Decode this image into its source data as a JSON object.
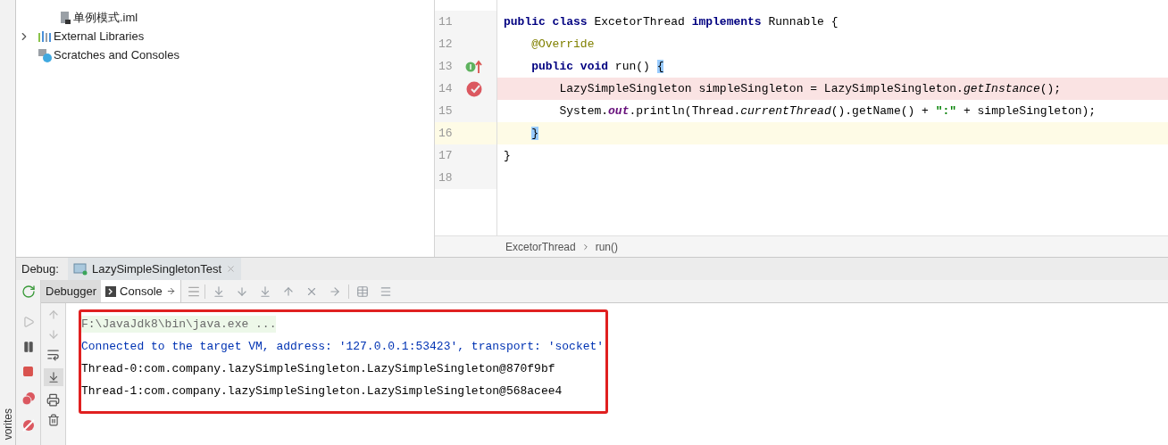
{
  "favorites_bar": {
    "label": "vorites"
  },
  "project_tree": {
    "items": [
      {
        "label": "单例模式.iml",
        "kind": "file"
      },
      {
        "label": "External Libraries",
        "kind": "libraries",
        "expanded": false
      },
      {
        "label": "Scratches and Consoles",
        "kind": "scratches"
      }
    ]
  },
  "editor": {
    "lines": [
      {
        "number": "11",
        "breakpoint": false,
        "caret_line": false,
        "implements_marker": false,
        "segments": [
          {
            "text": "public class ",
            "kind": "keyword"
          },
          {
            "text": "ExcetorThread ",
            "kind": "plain"
          },
          {
            "text": "implements ",
            "kind": "keyword"
          },
          {
            "text": "Runnable {",
            "kind": "plain"
          }
        ]
      },
      {
        "number": "12",
        "breakpoint": false,
        "caret_line": false,
        "implements_marker": false,
        "segments": [
          {
            "text": "    @Override",
            "kind": "annotation"
          }
        ]
      },
      {
        "number": "13",
        "breakpoint": false,
        "caret_line": false,
        "implements_marker": true,
        "segments": [
          {
            "text": "    public void ",
            "kind": "keyword"
          },
          {
            "text": "run() ",
            "kind": "plain"
          },
          {
            "text": "{",
            "kind": "brace-match"
          }
        ]
      },
      {
        "number": "14",
        "breakpoint": true,
        "caret_line": false,
        "implements_marker": false,
        "segments": [
          {
            "text": "        LazySimpleSingleton simpleSingleton = LazySimpleSingleton.",
            "kind": "plain"
          },
          {
            "text": "getInstance",
            "kind": "italic"
          },
          {
            "text": "();",
            "kind": "plain"
          }
        ]
      },
      {
        "number": "15",
        "breakpoint": false,
        "caret_line": false,
        "implements_marker": false,
        "segments": [
          {
            "text": "        System.",
            "kind": "plain"
          },
          {
            "text": "out",
            "kind": "static-field"
          },
          {
            "text": ".println(Thread.",
            "kind": "plain"
          },
          {
            "text": "currentThread",
            "kind": "italic"
          },
          {
            "text": "().getName() + ",
            "kind": "plain"
          },
          {
            "text": "\":\"",
            "kind": "string"
          },
          {
            "text": " + simpleSingleton);",
            "kind": "plain"
          }
        ]
      },
      {
        "number": "16",
        "breakpoint": false,
        "caret_line": true,
        "implements_marker": false,
        "segments": [
          {
            "text": "    }",
            "kind": "brace-match"
          }
        ]
      },
      {
        "number": "17",
        "breakpoint": false,
        "caret_line": false,
        "implements_marker": false,
        "segments": [
          {
            "text": "}",
            "kind": "plain"
          }
        ]
      },
      {
        "number": "18",
        "breakpoint": false,
        "caret_line": false,
        "implements_marker": false
      }
    ],
    "breadcrumbs": [
      "ExcetorThread",
      "run()"
    ]
  },
  "debug_panel": {
    "label": "Debug:",
    "session_tabs": [
      {
        "label": "LazySimpleSingletonTest",
        "selected": true
      }
    ],
    "view_tabs": [
      {
        "label": "Debugger",
        "selected": false
      },
      {
        "label": "Console",
        "selected": true
      }
    ],
    "console_lines": [
      {
        "text": "F:\\JavaJdk8\\bin\\java.exe ...",
        "kind": "command"
      },
      {
        "text": "Connected to the target VM, address: '127.0.0.1:53423', transport: 'socket'",
        "kind": "system"
      },
      {
        "text": "Thread-0:com.company.lazySimpleSingleton.LazySimpleSingleton@870f9bf",
        "kind": "output"
      },
      {
        "text": "Thread-1:com.company.lazySimpleSingleton.LazySimpleSingleton@568acee4",
        "kind": "output"
      }
    ]
  }
}
